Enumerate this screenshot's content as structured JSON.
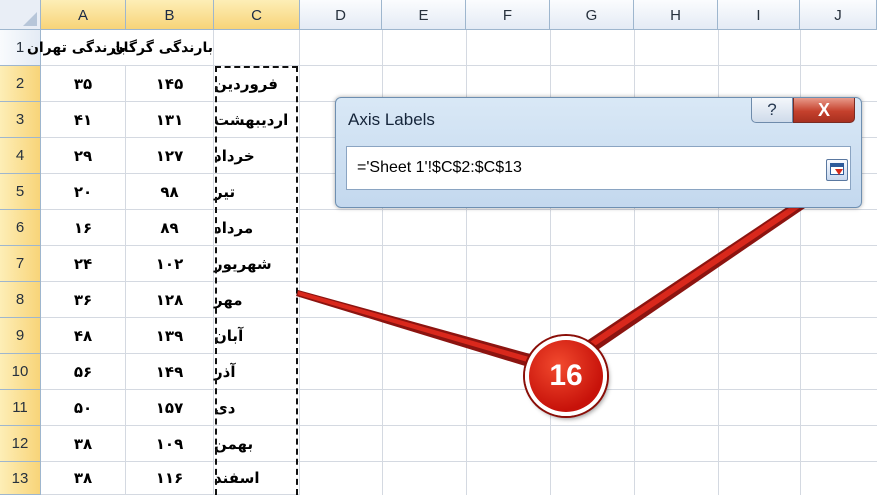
{
  "columns": [
    "A",
    "B",
    "C",
    "D",
    "E",
    "F",
    "G",
    "H",
    "I",
    "J"
  ],
  "rows": [
    "1",
    "2",
    "3",
    "4",
    "5",
    "6",
    "7",
    "8",
    "9",
    "10",
    "11",
    "12",
    "13"
  ],
  "headers": {
    "A1": "بارندگی تهران",
    "B1": "بارندگی گرگان"
  },
  "data": [
    {
      "a": "۳۵",
      "b": "۱۴۵",
      "month": "فروردین"
    },
    {
      "a": "۴۱",
      "b": "۱۳۱",
      "month": "اردیبهشت"
    },
    {
      "a": "۲۹",
      "b": "۱۲۷",
      "month": "خرداد"
    },
    {
      "a": "۲۰",
      "b": "۹۸",
      "month": "تیر"
    },
    {
      "a": "۱۶",
      "b": "۸۹",
      "month": "مرداد"
    },
    {
      "a": "۲۴",
      "b": "۱۰۲",
      "month": "شهریور"
    },
    {
      "a": "۳۶",
      "b": "۱۲۸",
      "month": "مهر"
    },
    {
      "a": "۴۸",
      "b": "۱۳۹",
      "month": "آبان"
    },
    {
      "a": "۵۶",
      "b": "۱۴۹",
      "month": "آذر"
    },
    {
      "a": "۵۰",
      "b": "۱۵۷",
      "month": "دی"
    },
    {
      "a": "۳۸",
      "b": "۱۰۹",
      "month": "بهمن"
    },
    {
      "a": "۳۸",
      "b": "۱۱۶",
      "month": "اسفند"
    }
  ],
  "dialog": {
    "title": "Axis Labels",
    "help_label": "?",
    "close_label": "X",
    "range_value": "='Sheet 1'!$C$2:$C$13",
    "collapse_icon": "collapse-dialog-icon"
  },
  "callout": {
    "label": "16"
  },
  "colors": {
    "header_selected": "#f8d479",
    "callout": "#c7120a",
    "dialog_bg": "#c3d8ee"
  }
}
